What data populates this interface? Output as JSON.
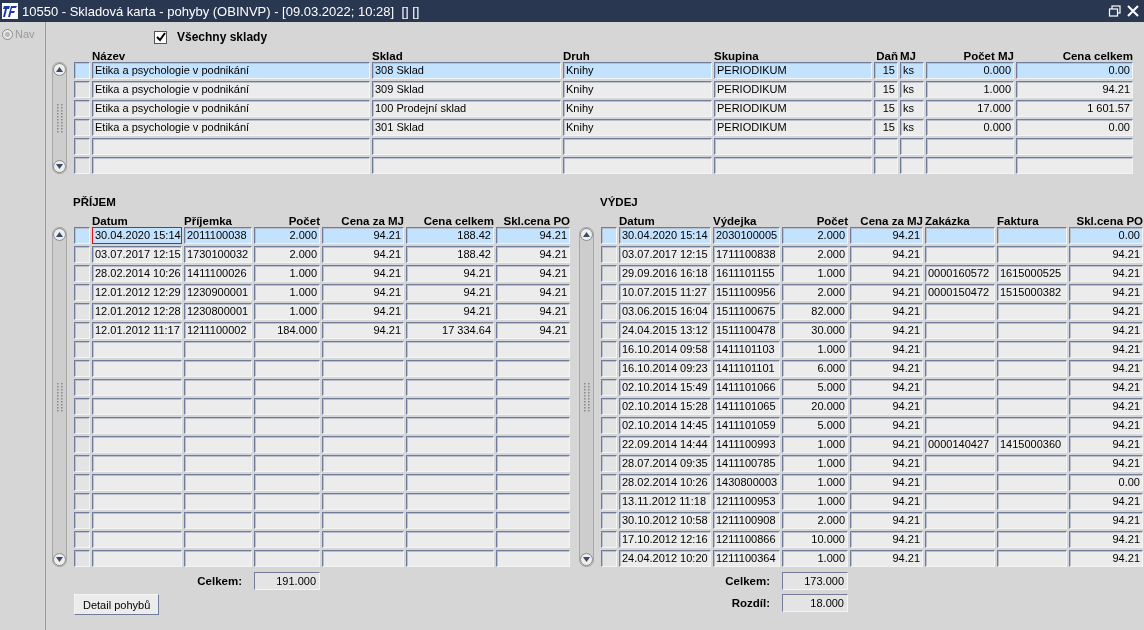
{
  "window": {
    "title": "10550 - Skladová karta - pohyby (OBINVP) - [09.03.2022; 10:28]  [] []"
  },
  "sidebar": {
    "nav": {
      "label": "Nav",
      "disabled": true
    }
  },
  "filter": {
    "label": "Všechny sklady",
    "checked": true
  },
  "items": {
    "columns": [
      "Název",
      "Sklad",
      "Druh",
      "Skupina",
      "Daň",
      "MJ",
      "Počet MJ",
      "Cena celkem"
    ],
    "rows": [
      {
        "selected": true,
        "cells": [
          "Etika a psychologie v podnikání",
          "308 Sklad",
          "Knihy",
          "PERIODIKUM",
          "15",
          "ks",
          "0.000",
          "0.00"
        ]
      },
      {
        "selected": false,
        "cells": [
          "Etika a psychologie v podnikání",
          "309 Sklad",
          "Knihy",
          "PERIODIKUM",
          "15",
          "ks",
          "1.000",
          "94.21"
        ]
      },
      {
        "selected": false,
        "cells": [
          "Etika a psychologie v podnikání",
          "100 Prodejní sklad",
          "Knihy",
          "PERIODIKUM",
          "15",
          "ks",
          "17.000",
          "1 601.57"
        ]
      },
      {
        "selected": false,
        "cells": [
          "Etika a psychologie v podnikání",
          "301 Sklad",
          "Knihy",
          "PERIODIKUM",
          "15",
          "ks",
          "0.000",
          "0.00"
        ]
      }
    ]
  },
  "prijem": {
    "title": "PŘÍJEM",
    "columns": [
      "Datum",
      "Příjemka",
      "Počet",
      "Cena za MJ",
      "Cena celkem",
      "Skl.cena PO"
    ],
    "rows": [
      {
        "selected": true,
        "focused": true,
        "cells": [
          "30.04.2020 15:14",
          "2011100038",
          "2.000",
          "94.21",
          "188.42",
          "94.21"
        ]
      },
      {
        "selected": false,
        "focused": false,
        "cells": [
          "03.07.2017 12:15",
          "1730100032",
          "2.000",
          "94.21",
          "188.42",
          "94.21"
        ]
      },
      {
        "selected": false,
        "focused": false,
        "cells": [
          "28.02.2014 10:26",
          "1411100026",
          "1.000",
          "94.21",
          "94.21",
          "94.21"
        ]
      },
      {
        "selected": false,
        "focused": false,
        "cells": [
          "12.01.2012 12:29",
          "1230900001",
          "1.000",
          "94.21",
          "94.21",
          "94.21"
        ]
      },
      {
        "selected": false,
        "focused": false,
        "cells": [
          "12.01.2012 12:28",
          "1230800001",
          "1.000",
          "94.21",
          "94.21",
          "94.21"
        ]
      },
      {
        "selected": false,
        "focused": false,
        "cells": [
          "12.01.2012 11:17",
          "1211100002",
          "184.000",
          "94.21",
          "17 334.64",
          "94.21"
        ]
      }
    ],
    "total_label": "Celkem:",
    "total": "191.000"
  },
  "vydej": {
    "title": "VÝDEJ",
    "columns": [
      "Datum",
      "Výdejka",
      "Počet",
      "Cena za MJ",
      "Zakázka",
      "Faktura",
      "Skl.cena PO"
    ],
    "rows": [
      {
        "selected": true,
        "cells": [
          "30.04.2020 15:14",
          "2030100005",
          "2.000",
          "94.21",
          null,
          null,
          "0.00"
        ]
      },
      {
        "selected": false,
        "cells": [
          "03.07.2017 12:15",
          "1711100838",
          "2.000",
          "94.21",
          null,
          null,
          "94.21"
        ]
      },
      {
        "selected": false,
        "cells": [
          "29.09.2016 16:18",
          "1611101155",
          "1.000",
          "94.21",
          "0000160572",
          "1615000525",
          "94.21"
        ]
      },
      {
        "selected": false,
        "cells": [
          "10.07.2015 11:27",
          "1511100956",
          "2.000",
          "94.21",
          "0000150472",
          "1515000382",
          "94.21"
        ]
      },
      {
        "selected": false,
        "cells": [
          "03.06.2015 16:04",
          "1511100675",
          "82.000",
          "94.21",
          null,
          null,
          "94.21"
        ]
      },
      {
        "selected": false,
        "cells": [
          "24.04.2015 13:12",
          "1511100478",
          "30.000",
          "94.21",
          null,
          null,
          "94.21"
        ]
      },
      {
        "selected": false,
        "cells": [
          "16.10.2014 09:58",
          "1411101103",
          "1.000",
          "94.21",
          null,
          null,
          "94.21"
        ]
      },
      {
        "selected": false,
        "cells": [
          "16.10.2014 09:23",
          "1411101101",
          "6.000",
          "94.21",
          null,
          null,
          "94.21"
        ]
      },
      {
        "selected": false,
        "cells": [
          "02.10.2014 15:49",
          "1411101066",
          "5.000",
          "94.21",
          null,
          null,
          "94.21"
        ]
      },
      {
        "selected": false,
        "cells": [
          "02.10.2014 15:28",
          "1411101065",
          "20.000",
          "94.21",
          null,
          null,
          "94.21"
        ]
      },
      {
        "selected": false,
        "cells": [
          "02.10.2014 14:45",
          "1411101059",
          "5.000",
          "94.21",
          null,
          null,
          "94.21"
        ]
      },
      {
        "selected": false,
        "cells": [
          "22.09.2014 14:44",
          "1411100993",
          "1.000",
          "94.21",
          "0000140427",
          "1415000360",
          "94.21"
        ]
      },
      {
        "selected": false,
        "cells": [
          "28.07.2014 09:35",
          "1411100785",
          "1.000",
          "94.21",
          null,
          null,
          "94.21"
        ]
      },
      {
        "selected": false,
        "cells": [
          "28.02.2014 10:26",
          "1430800003",
          "1.000",
          "94.21",
          null,
          null,
          "0.00"
        ]
      },
      {
        "selected": false,
        "cells": [
          "13.11.2012 11:18",
          "1211100953",
          "1.000",
          "94.21",
          null,
          null,
          "94.21"
        ]
      },
      {
        "selected": false,
        "cells": [
          "30.10.2012 10:58",
          "1211100908",
          "2.000",
          "94.21",
          null,
          null,
          "94.21"
        ]
      },
      {
        "selected": false,
        "cells": [
          "17.10.2012 12:16",
          "1211100866",
          "10.000",
          "94.21",
          null,
          null,
          "94.21"
        ]
      },
      {
        "selected": false,
        "cells": [
          "24.04.2012 10:20",
          "1211100364",
          "1.000",
          "94.21",
          null,
          null,
          "94.21"
        ]
      }
    ],
    "total_label": "Celkem:",
    "total": "173.000",
    "difference_label": "Rozdíl:",
    "difference": "18.000"
  },
  "detail_button": {
    "label": "Detail pohybů"
  }
}
